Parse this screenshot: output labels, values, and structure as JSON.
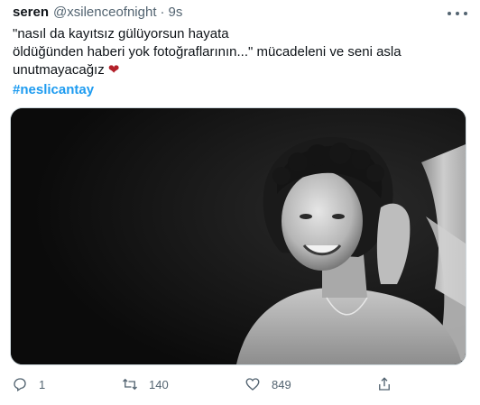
{
  "tweet": {
    "display_name": "seren",
    "handle": "@xsilenceofnight",
    "separator": "·",
    "time": "9s",
    "text_lines": [
      "\"nasıl da kayıtsız gülüyorsun hayata",
      "öldüğünden haberi yok fotoğraflarının...\" mücadeleni ve seni asla",
      "unutmayacağız"
    ],
    "heart": "❤",
    "hashtag": "#neslicantay"
  },
  "actions": {
    "reply_count": "1",
    "retweet_count": "140",
    "like_count": "849",
    "reply_icon": "reply-icon",
    "retweet_icon": "retweet-icon",
    "like_icon": "like-icon",
    "share_icon": "share-icon"
  },
  "colors": {
    "text": "#0f1419",
    "muted": "#536471",
    "hashtag": "#1d9bf0",
    "heart": "#b3202a"
  }
}
